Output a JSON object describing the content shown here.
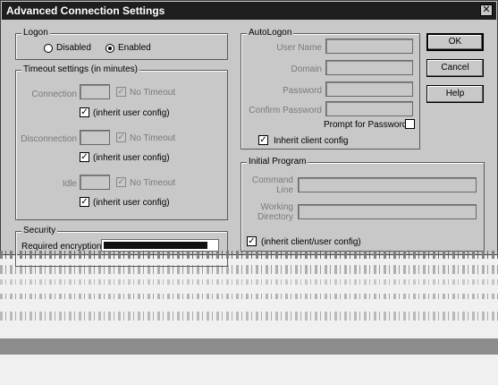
{
  "dialog": {
    "title": "Advanced Connection Settings",
    "close_label": "✕"
  },
  "logon": {
    "group_label": "Logon",
    "disabled_label": "Disabled",
    "enabled_label": "Enabled",
    "selected": "enabled"
  },
  "timeout": {
    "group_label": "Timeout settings (in minutes)",
    "no_timeout_label": "No Timeout",
    "inherit_label": "(inherit user config)",
    "rows": [
      {
        "label": "Connection",
        "value": "",
        "no_timeout": true,
        "inherit": true
      },
      {
        "label": "Disconnection",
        "value": "",
        "no_timeout": true,
        "inherit": true
      },
      {
        "label": "Idle",
        "value": "",
        "no_timeout": true,
        "inherit": true
      }
    ]
  },
  "security": {
    "group_label": "Security",
    "required_encryption_label": "Required encryption"
  },
  "autologon": {
    "group_label": "AutoLogon",
    "user_name_label": "User Name",
    "domain_label": "Domain",
    "password_label": "Password",
    "confirm_password_label": "Confirm Password",
    "prompt_password_label": "Prompt for Password",
    "prompt_password_checked": false,
    "inherit_client_label": "Inherit client config",
    "inherit_client_checked": true
  },
  "initial_program": {
    "group_label": "Initial Program",
    "command_line_label_1": "Command",
    "command_line_label_2": "Line",
    "working_dir_label_1": "Working",
    "working_dir_label_2": "Directory",
    "inherit_label": "(inherit client/user config)",
    "inherit_checked": true
  },
  "buttons": {
    "ok": "OK",
    "cancel": "Cancel",
    "help": "Help"
  },
  "check_mark": "✓"
}
